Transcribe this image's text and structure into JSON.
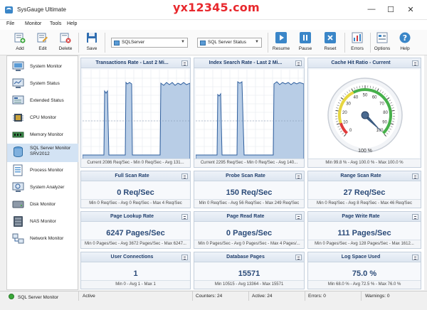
{
  "watermark": "yx12345.com",
  "window": {
    "title": "SysGauge Ultimate",
    "controls": [
      "—",
      "☐",
      "✕"
    ]
  },
  "menu": [
    "File",
    "Monitor",
    "Tools",
    "Help"
  ],
  "toolbar": {
    "add": "Add",
    "edit": "Edit",
    "delete": "Delete",
    "save": "Save",
    "combo1": "SQLServer",
    "combo2": "SQL Server Status",
    "resume": "Resume",
    "pause": "Pause",
    "reset": "Reset",
    "errors": "Errors",
    "options": "Options",
    "help": "Help"
  },
  "sidebar": {
    "items": [
      {
        "label": "System Monitor",
        "icon": "computer-icon"
      },
      {
        "label": "System Status",
        "icon": "monitor-status-icon"
      },
      {
        "label": "Extended Status",
        "icon": "extended-status-icon"
      },
      {
        "label": "CPU Monitor",
        "icon": "cpu-icon"
      },
      {
        "label": "Memory Monitor",
        "icon": "memory-icon"
      },
      {
        "label": "SQL Server Monitor",
        "label2": "SRV2012",
        "icon": "database-icon",
        "selected": true
      },
      {
        "label": "Process Monitor",
        "icon": "process-icon"
      },
      {
        "label": "System Analyzer",
        "icon": "analyzer-icon"
      },
      {
        "label": "Disk Monitor",
        "icon": "disk-icon"
      },
      {
        "label": "NAS Monitor",
        "icon": "nas-icon"
      },
      {
        "label": "Network Monitor",
        "icon": "network-icon"
      }
    ]
  },
  "panels": {
    "transactions": {
      "title": "Transactions Rate - Last 2 Mi...",
      "footer": "Current 2086 Req/Sec - Min 0 Req/Sec - Avg 131..."
    },
    "index_search": {
      "title": "Index Search Rate - Last 2 Mi...",
      "footer": "Current 2295 Req/Sec - Min 0 Req/Sec - Avg 140..."
    },
    "cache_hit": {
      "title": "Cache Hit Ratio - Current",
      "footer": "Min 99.8 % - Avg 100.0 % - Max 100.0 %",
      "gauge_unit": "100 %",
      "value": 100
    },
    "full_scan": {
      "title": "Full Scan Rate",
      "value": "0 Req/Sec",
      "footer": "Min 0 Req/Sec - Avg 0 Req/Sec - Max 4 Req/Sec"
    },
    "probe_scan": {
      "title": "Probe Scan Rate",
      "value": "150 Req/Sec",
      "footer": "Min 0 Req/Sec - Avg 56 Req/Sec - Max 249 Req/Sec"
    },
    "range_scan": {
      "title": "Range Scan Rate",
      "value": "27 Req/Sec",
      "footer": "Min 0 Req/Sec - Avg 8 Req/Sec - Max 46 Req/Sec"
    },
    "page_lookup": {
      "title": "Page Lookup Rate",
      "value": "6247 Pages/Sec",
      "footer": "Min 0 Pages/Sec - Avg 3672 Pages/Sec - Max 6247..."
    },
    "page_read": {
      "title": "Page Read Rate",
      "value": "0 Pages/Sec",
      "footer": "Min 0 Pages/Sec - Avg 0 Pages/Sec - Max 4 Pages/..."
    },
    "page_write": {
      "title": "Page Write Rate",
      "value": "111 Pages/Sec",
      "footer": "Min 0 Pages/Sec - Avg 128 Pages/Sec - Max 1612..."
    },
    "user_conn": {
      "title": "User Connections",
      "value": "1",
      "footer": "Min 0 - Avg 1 - Max 1"
    },
    "db_pages": {
      "title": "Database Pages",
      "value": "15571",
      "footer": "Min 10515 - Avg 13364 - Max 15571"
    },
    "log_space": {
      "title": "Log Space Used",
      "value": "75.0 %",
      "footer": "Min 68.0 % - Avg 72.5 % - Max 76.0 %"
    }
  },
  "gauge": {
    "ticks": [
      "0",
      "10",
      "20",
      "30",
      "40",
      "50",
      "60",
      "70",
      "80",
      "90",
      "100"
    ],
    "value": 100
  },
  "status": {
    "monitor": "SQL Server Monitor",
    "state": "Active",
    "counters": "Counters: 24",
    "active": "Active: 24",
    "errors": "Errors: 0",
    "warnings": "Warnings: 0"
  },
  "colors": {
    "accent": "#3a6fb0",
    "chart_fill": "#b8cde6",
    "chart_line": "#2f5f9e",
    "selected": "#d3e3f4",
    "status_ok": "#3aa83a"
  }
}
